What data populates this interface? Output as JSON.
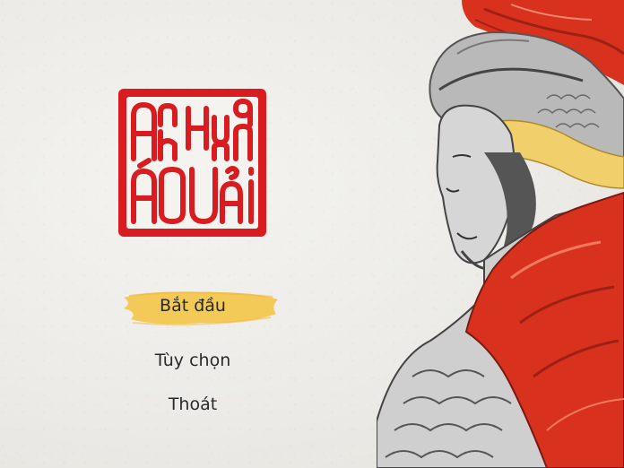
{
  "game": {
    "title_logo_text": "Anh Hùng Áo Vải"
  },
  "menu": {
    "items": [
      {
        "id": "start",
        "label": "Bắt đầu",
        "selected": true
      },
      {
        "id": "options",
        "label": "Tùy chọn",
        "selected": false
      },
      {
        "id": "quit",
        "label": "Thoát",
        "selected": false
      }
    ]
  },
  "colors": {
    "seal_red": "#d81c1f",
    "highlight_yellow": "#f3c64b",
    "armor_red": "#d8321f",
    "scarf_yellow": "#f1cf6a",
    "background": "#efeeeb"
  },
  "icons": {
    "logo": "seal-logo",
    "hero": "warrior-portrait"
  }
}
